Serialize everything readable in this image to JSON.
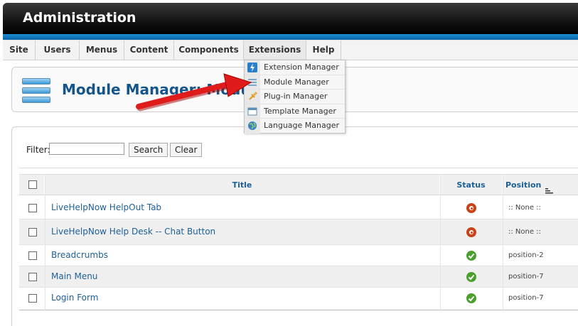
{
  "header": {
    "title": "Administration"
  },
  "menubar": {
    "items": [
      "Site",
      "Users",
      "Menus",
      "Content",
      "Components",
      "Extensions",
      "Help"
    ]
  },
  "dropdown": {
    "items": [
      {
        "label": "Extension Manager",
        "icon": "extension-manager-icon"
      },
      {
        "label": "Module Manager",
        "icon": "module-manager-icon"
      },
      {
        "label": "Plug-in Manager",
        "icon": "plugin-manager-icon"
      },
      {
        "label": "Template Manager",
        "icon": "template-manager-icon"
      },
      {
        "label": "Language Manager",
        "icon": "language-manager-icon"
      }
    ]
  },
  "toolbar": {
    "page_title": "Module Manager: Modules"
  },
  "filter": {
    "label": "Filter:",
    "value": "",
    "search_label": "Search",
    "clear_label": "Clear"
  },
  "table": {
    "headers": {
      "title": "Title",
      "status": "Status",
      "position": "Position"
    },
    "rows": [
      {
        "title": "LiveHelpNow HelpOut Tab",
        "status": "disabled",
        "position": ":: None ::"
      },
      {
        "title": "LiveHelpNow Help Desk -- Chat Button",
        "status": "disabled",
        "position": ":: None ::"
      },
      {
        "title": "Breadcrumbs",
        "status": "enabled",
        "position": "position-2"
      },
      {
        "title": "Main Menu",
        "status": "enabled",
        "position": "position-7"
      },
      {
        "title": "Login Form",
        "status": "enabled",
        "position": "position-7"
      }
    ]
  },
  "colors": {
    "accent_blue": "#1d5f97",
    "header_black": "#111111",
    "strip_blue": "#0b63a8",
    "status_enabled": "#4aa02c",
    "status_disabled": "#c8431a",
    "arrow_red": "#e01b1b"
  }
}
